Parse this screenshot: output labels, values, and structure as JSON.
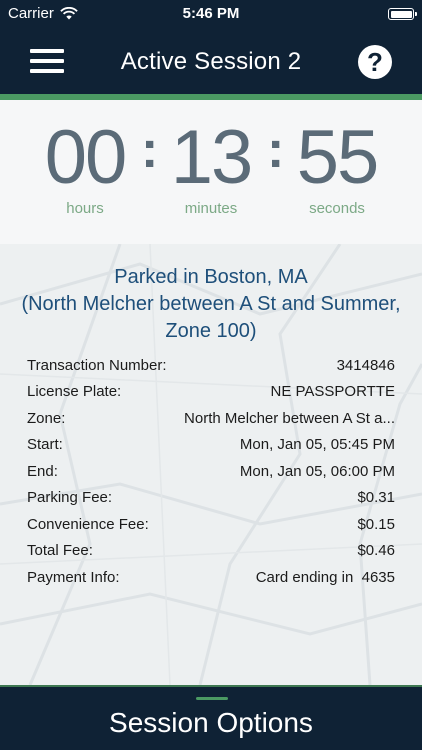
{
  "status_bar": {
    "carrier": "Carrier",
    "time": "5:46 PM",
    "wifi_icon": "wifi-icon",
    "battery_icon": "battery-icon"
  },
  "header": {
    "title": "Active Session 2",
    "menu_icon": "hamburger-menu-icon",
    "help_icon": "help-question-icon",
    "help_glyph": "?",
    "accent_color": "#4b9a63",
    "background_color": "#0f2235"
  },
  "timer": {
    "hours": "00",
    "minutes": "13",
    "seconds": "55",
    "separator": ":",
    "hours_label": "hours",
    "minutes_label": "minutes",
    "seconds_label": "seconds"
  },
  "session": {
    "location_line1": "Parked in Boston, MA",
    "location_line2": "(North Melcher between A St and Summer,",
    "location_line3": "Zone 100)",
    "rows": [
      {
        "label": "Transaction Number:",
        "value": "3414846"
      },
      {
        "label": "License Plate:",
        "value": "NE PASSPORTTE"
      },
      {
        "label": "Zone:",
        "value": "North Melcher between A St a..."
      },
      {
        "label": "Start:",
        "value": "Mon, Jan 05, 05:45 PM"
      },
      {
        "label": "End:",
        "value": "Mon, Jan 05, 06:00 PM"
      },
      {
        "label": "Parking Fee:",
        "value": "$0.31"
      },
      {
        "label": "Convenience Fee:",
        "value": "$0.15"
      },
      {
        "label": "Total Fee:",
        "value": "$0.46"
      },
      {
        "label": "Payment Info:",
        "value": "Card ending in  4635"
      }
    ]
  },
  "bottom": {
    "label": "Session Options"
  }
}
